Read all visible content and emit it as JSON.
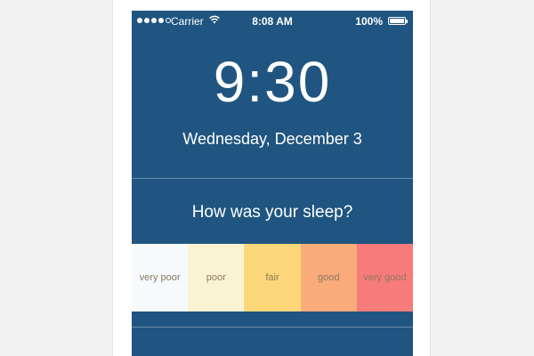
{
  "status_bar": {
    "carrier": "Carrier",
    "time": "8:08 AM",
    "battery": "100%"
  },
  "lock": {
    "time": "9:30",
    "date": "Wednesday, December 3"
  },
  "sleep": {
    "question": "How was your sleep?",
    "options": [
      {
        "label": "very poor",
        "color": "#f7fafc"
      },
      {
        "label": "poor",
        "color": "#faf3d3"
      },
      {
        "label": "fair",
        "color": "#fbd77a"
      },
      {
        "label": "good",
        "color": "#f9ab7a"
      },
      {
        "label": "very good",
        "color": "#f77b7b"
      }
    ]
  }
}
